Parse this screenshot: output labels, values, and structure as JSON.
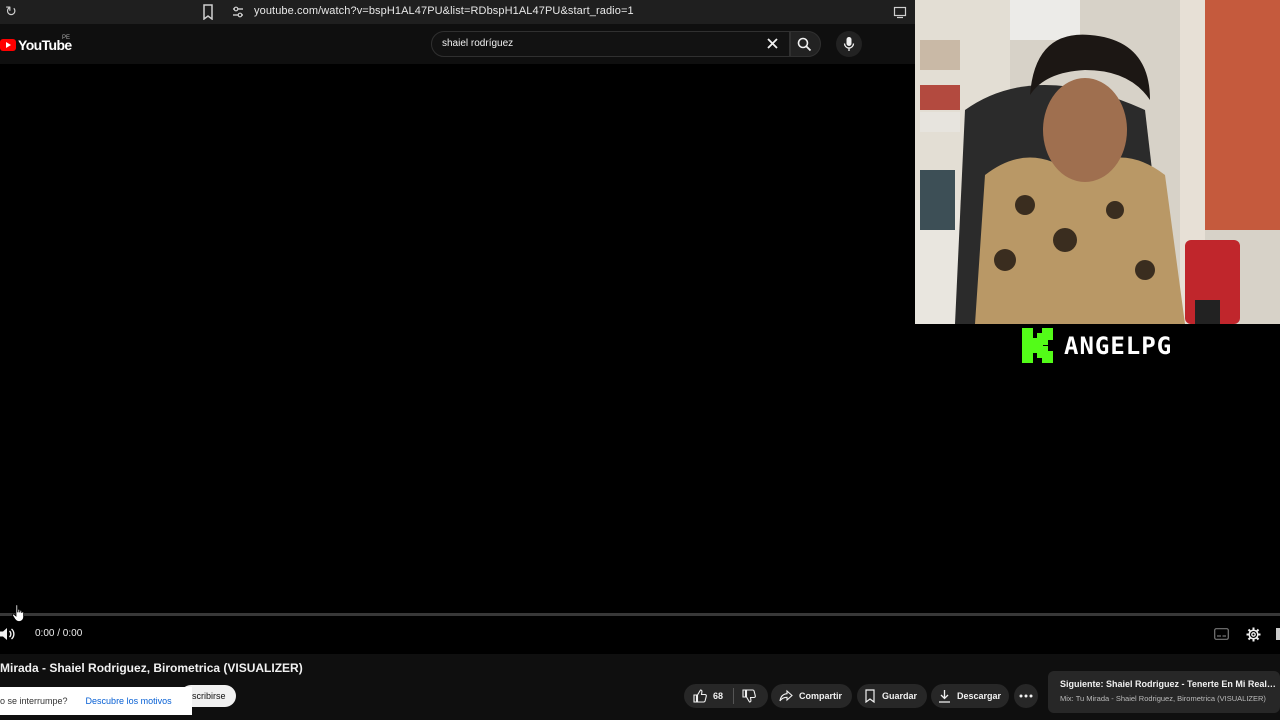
{
  "browser": {
    "url": "youtube.com/watch?v=bspH1AL47PU&list=RDbspH1AL47PU&start_radio=1"
  },
  "youtube": {
    "logo_text": "YouTube",
    "country_code": "PE",
    "search_query": "shaiel rodríguez"
  },
  "stream_overlay": {
    "streamer_name": "ANGELPG",
    "platform_icon": "kick-logo",
    "accent_color": "#53fc18"
  },
  "player": {
    "time_display": "0:00 / 0:00",
    "progress_fraction": 0
  },
  "video": {
    "title": "Mirada - Shaiel Rodriguez, Birometrica (VISUALIZER)",
    "subscribe_label": "scribirse",
    "notice_text": "o se interrumpe?",
    "notice_link": "Descubre los motivos",
    "actions": {
      "like_count": "68",
      "share_label": "Compartir",
      "save_label": "Guardar",
      "download_label": "Descargar"
    },
    "next": {
      "title": "Siguiente: Shaiel Rodriguez - Tenerte En Mi Realida...",
      "subtitle": "Mix: Tu Mirada - Shaiel Rodriguez, Birometrica (VISUALIZER)"
    }
  }
}
